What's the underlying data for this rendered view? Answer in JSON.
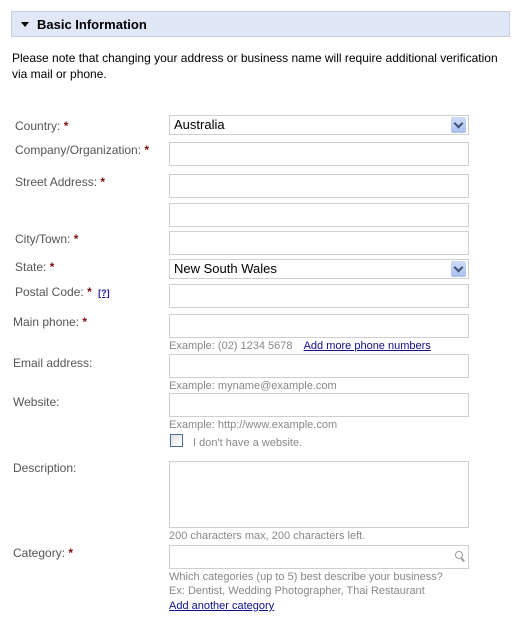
{
  "section": {
    "title": "Basic Information",
    "notice": "Please note that changing your address or business name will require additional verification via mail or phone."
  },
  "form": {
    "required_marker": "*",
    "country": {
      "label": "Country:",
      "value": "Australia"
    },
    "company": {
      "label": "Company/Organization:",
      "value": ""
    },
    "street": {
      "label": "Street Address:",
      "value_line1": "",
      "value_line2": ""
    },
    "city": {
      "label": "City/Town:",
      "value": ""
    },
    "state": {
      "label": "State:",
      "value": "New South Wales"
    },
    "postal": {
      "label": "Postal Code:",
      "help": "[?]",
      "value": ""
    },
    "phone": {
      "label": "Main phone:",
      "value": "",
      "hint": "Example: (02) 1234 5678",
      "add_link": "Add more phone numbers"
    },
    "email": {
      "label": "Email address:",
      "value": "",
      "hint": "Example: myname@example.com"
    },
    "website": {
      "label": "Website:",
      "value": "",
      "hint": "Example: http://www.example.com",
      "no_website_label": "I don't have a website.",
      "no_website_checked": false
    },
    "description": {
      "label": "Description:",
      "value": "",
      "hint": "200 characters max, 200 characters left."
    },
    "category": {
      "label": "Category:",
      "value": "",
      "hint_line1": "Which categories (up to 5) best describe your business?",
      "hint_line2": "Ex: Dentist, Wedding Photographer, Thai Restaurant",
      "add_link": "Add another category"
    }
  }
}
